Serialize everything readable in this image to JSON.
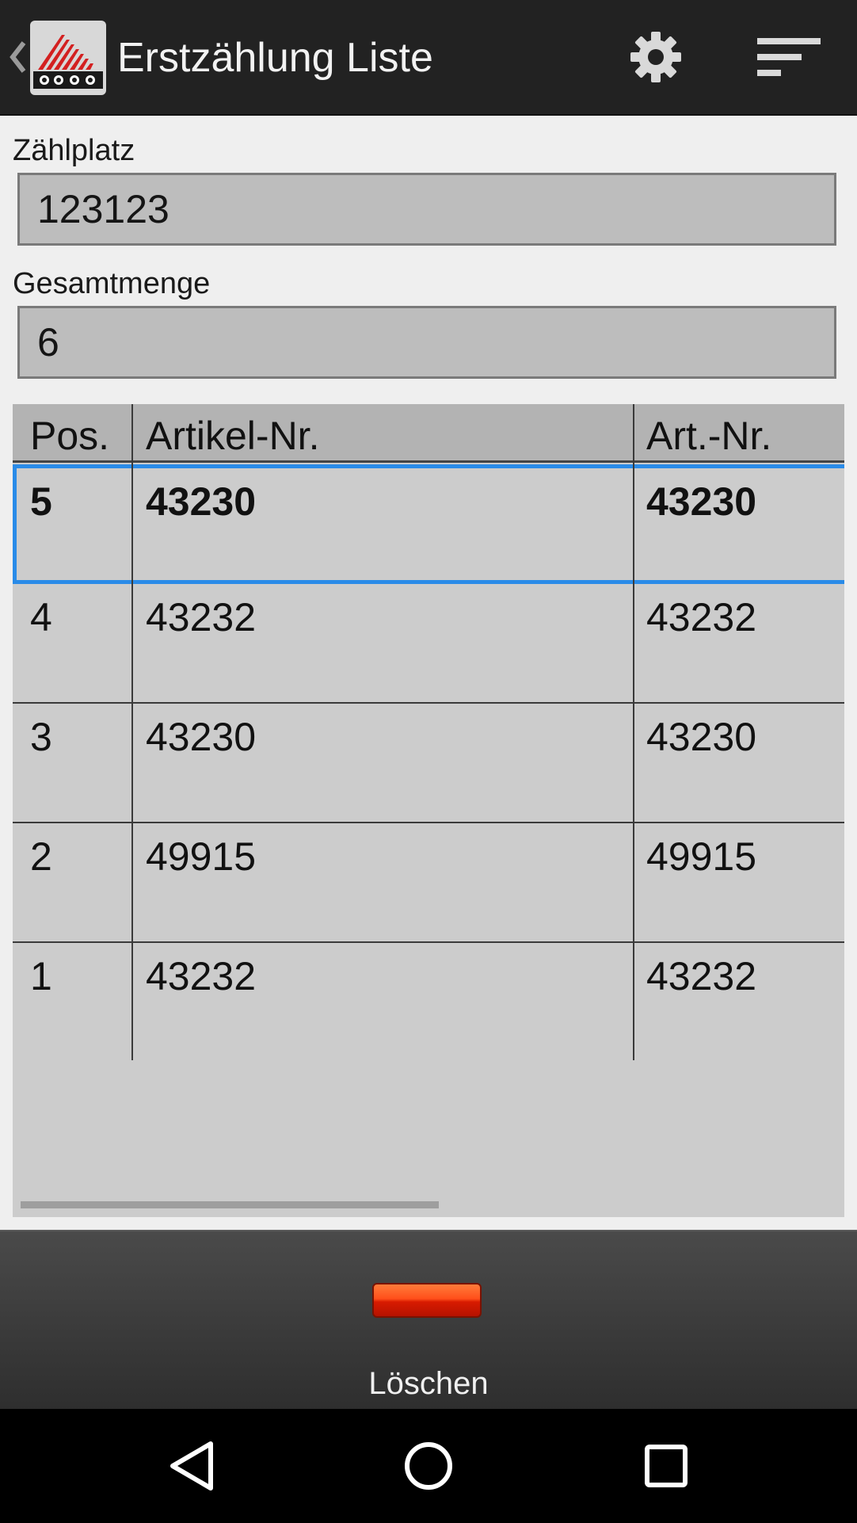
{
  "actionbar": {
    "title": "Erstzählung Liste",
    "back_icon": "chevron-left-icon",
    "logo": "app-logo",
    "settings_icon": "gear-icon",
    "sort_icon": "sort-lines-icon"
  },
  "form": {
    "location_label": "Zählplatz",
    "location_value": "123123",
    "total_label": "Gesamtmenge",
    "total_value": "6"
  },
  "table": {
    "columns": [
      "Pos.",
      "Artikel-Nr.",
      "Art.-Nr."
    ],
    "rows": [
      {
        "pos": "5",
        "artikel_nr": "43230",
        "art_nr": "43230",
        "selected": true
      },
      {
        "pos": "4",
        "artikel_nr": "43232",
        "art_nr": "43232"
      },
      {
        "pos": "3",
        "artikel_nr": "43230",
        "art_nr": "43230"
      },
      {
        "pos": "2",
        "artikel_nr": "49915",
        "art_nr": "49915"
      },
      {
        "pos": "1",
        "artikel_nr": "43232",
        "art_nr": "43232"
      }
    ]
  },
  "toolbar": {
    "delete_label": "Löschen",
    "delete_icon": "minus-bar-icon"
  },
  "navbar": {
    "back": "nav-back-icon",
    "home": "nav-home-icon",
    "recents": "nav-recents-icon"
  },
  "colors": {
    "actionbar": "#222222",
    "selection": "#2a8be8",
    "delete": "#e53a10"
  }
}
